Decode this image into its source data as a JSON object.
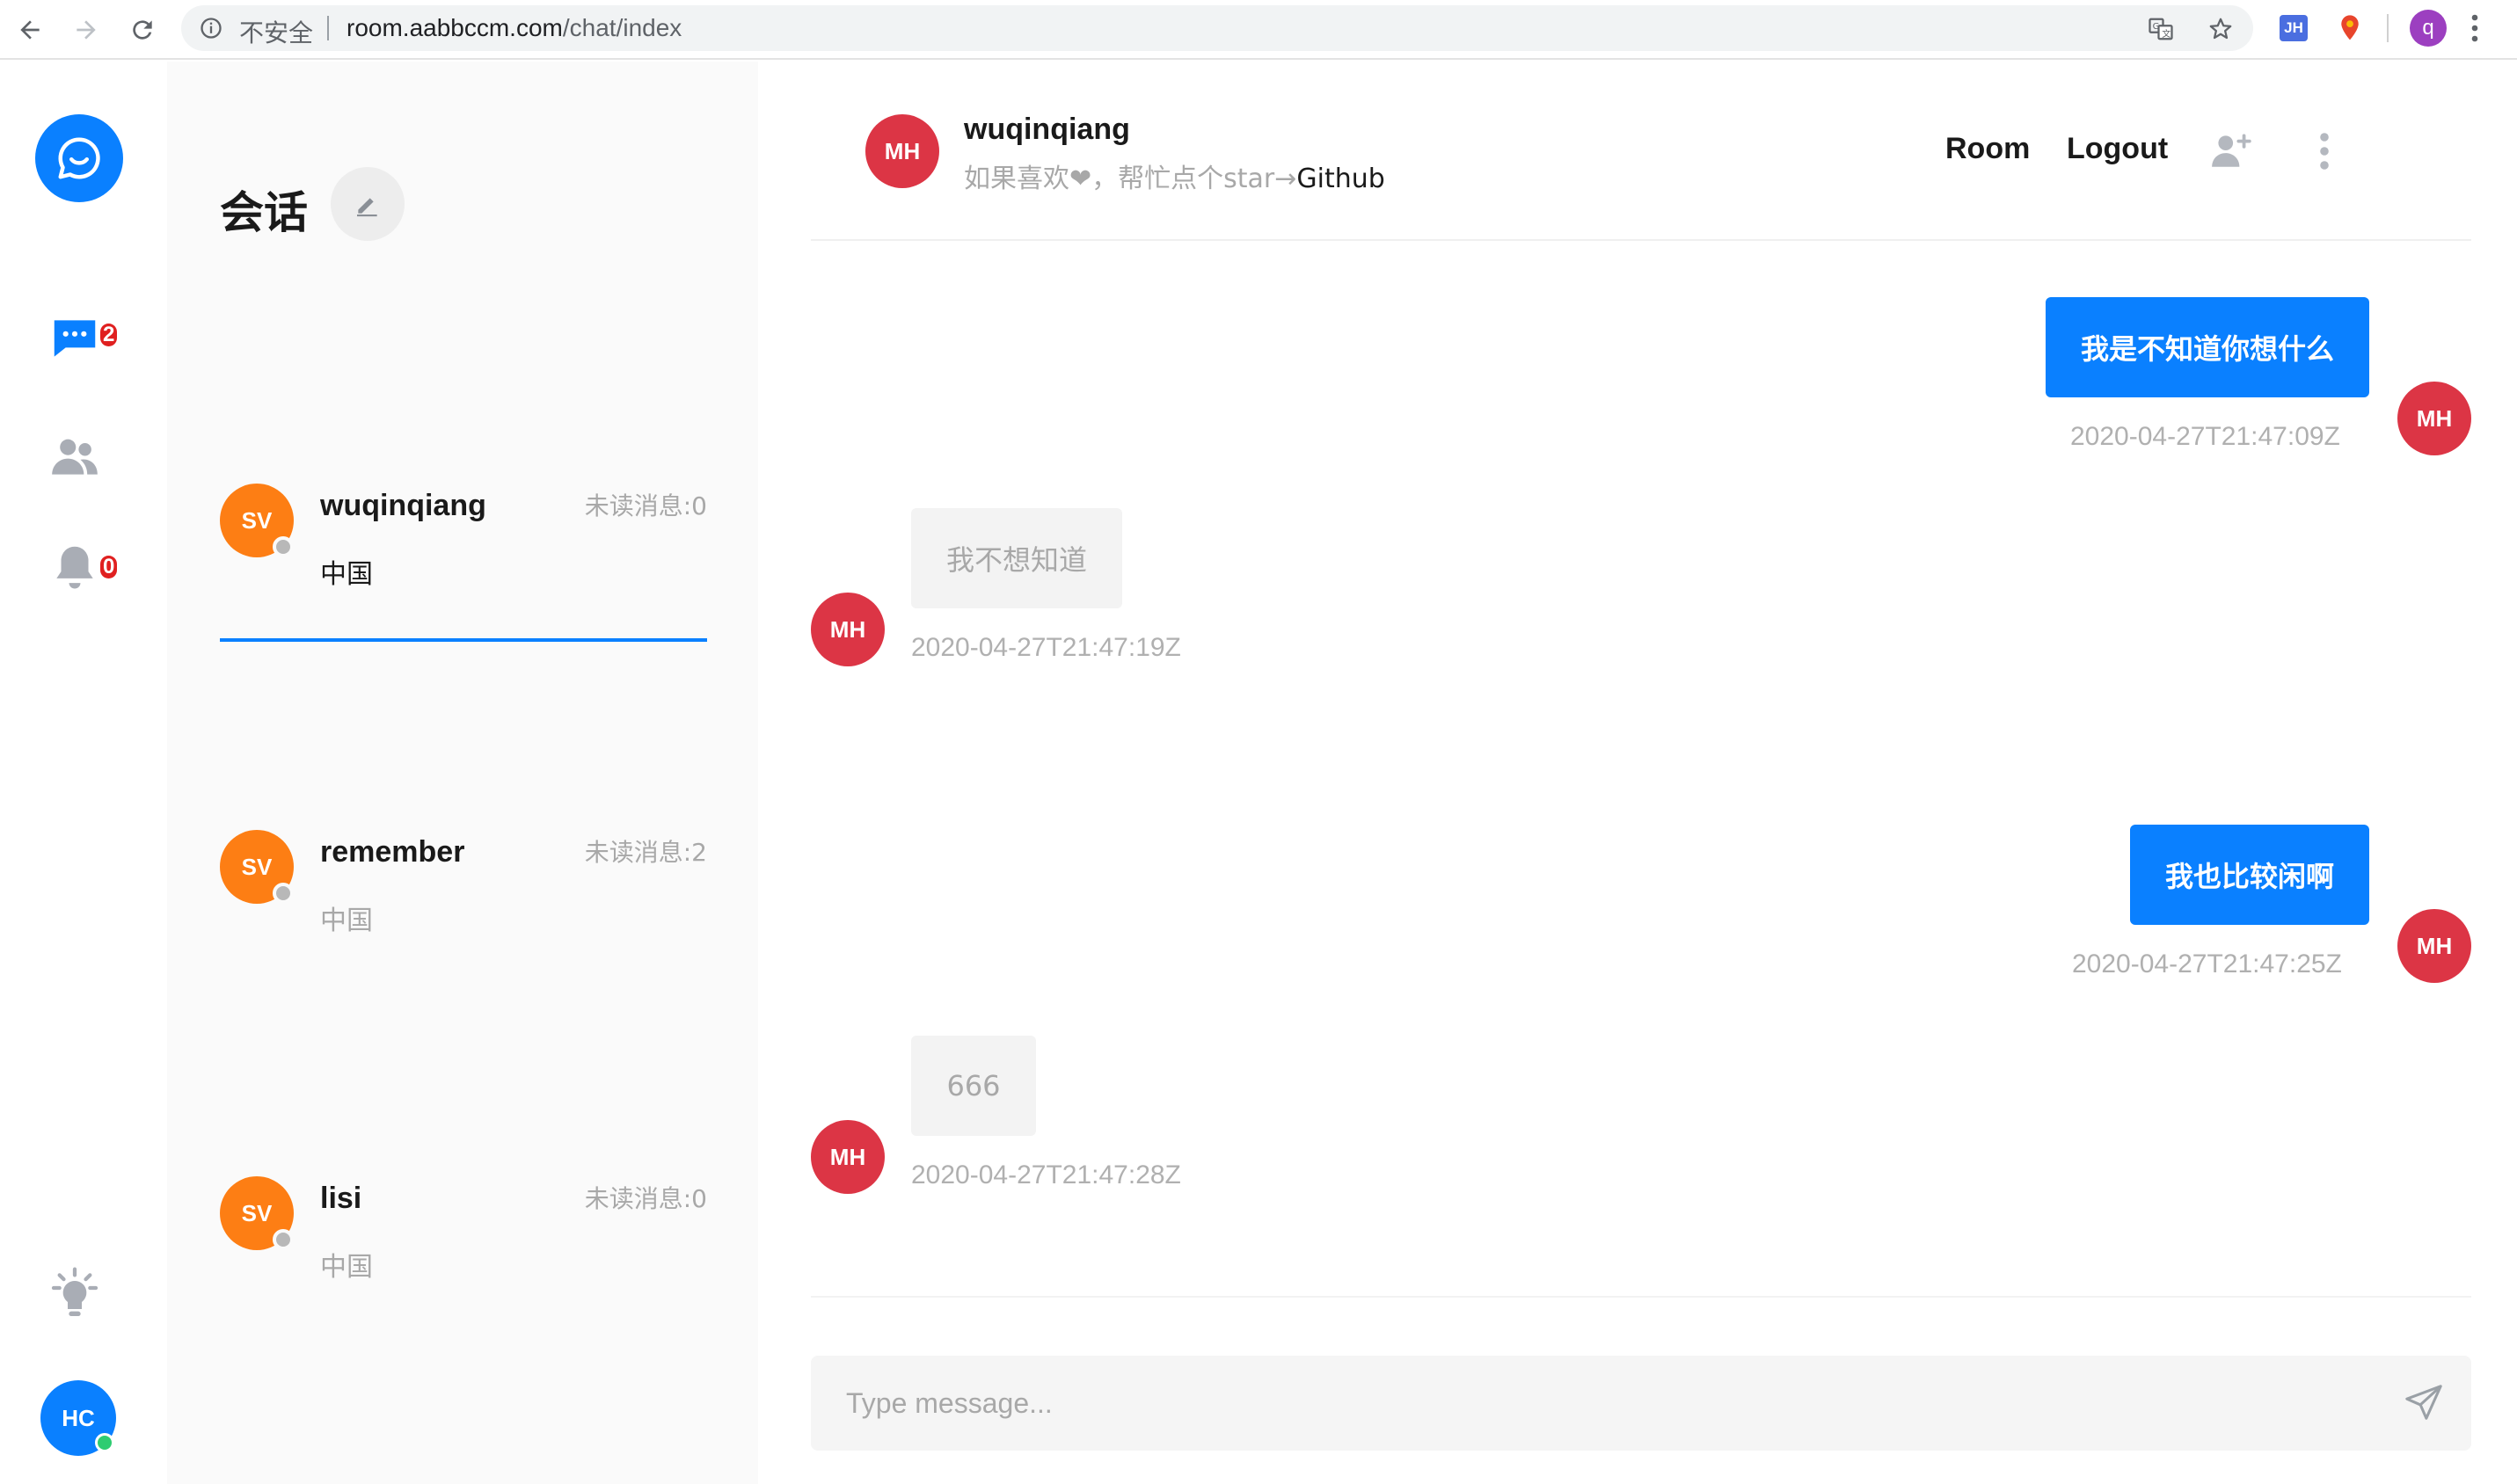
{
  "browser": {
    "security_label": "不安全",
    "url_host": "room.aabbccm.com",
    "url_path": "/chat/index",
    "extension_jh": "JH",
    "profile_initial": "q"
  },
  "nav": {
    "chat_badge": "2",
    "notification_badge": "0",
    "user_initials": "HC",
    "colors": {
      "primary": "#0a80ff",
      "badge": "#e02020",
      "online": "#2ecc71"
    }
  },
  "conversations": {
    "title": "会话",
    "items": [
      {
        "avatar": "SV",
        "name": "wuqinqiang",
        "unread": "未读消息:0",
        "subtitle": "中国"
      },
      {
        "avatar": "SV",
        "name": "remember",
        "unread": "未读消息:2",
        "subtitle": "中国"
      },
      {
        "avatar": "SV",
        "name": "lisi",
        "unread": "未读消息:0",
        "subtitle": "中国"
      }
    ]
  },
  "chat": {
    "header": {
      "avatar": "MH",
      "name": "wuqinqiang",
      "subtitle": "如果喜欢❤，帮忙点个star→",
      "subtitle_link": "Github",
      "room_label": "Room",
      "logout_label": "Logout"
    },
    "messages": [
      {
        "direction": "out",
        "avatar": "MH",
        "text": "我是不知道你想什么",
        "time": "2020-04-27T21:47:09Z"
      },
      {
        "direction": "in",
        "avatar": "MH",
        "text": "我不想知道",
        "time": "2020-04-27T21:47:19Z"
      },
      {
        "direction": "out",
        "avatar": "MH",
        "text": "我也比较闲啊",
        "time": "2020-04-27T21:47:25Z"
      },
      {
        "direction": "in",
        "avatar": "MH",
        "text": "666",
        "time": "2020-04-27T21:47:28Z"
      }
    ],
    "composer": {
      "placeholder": "Type message..."
    }
  }
}
